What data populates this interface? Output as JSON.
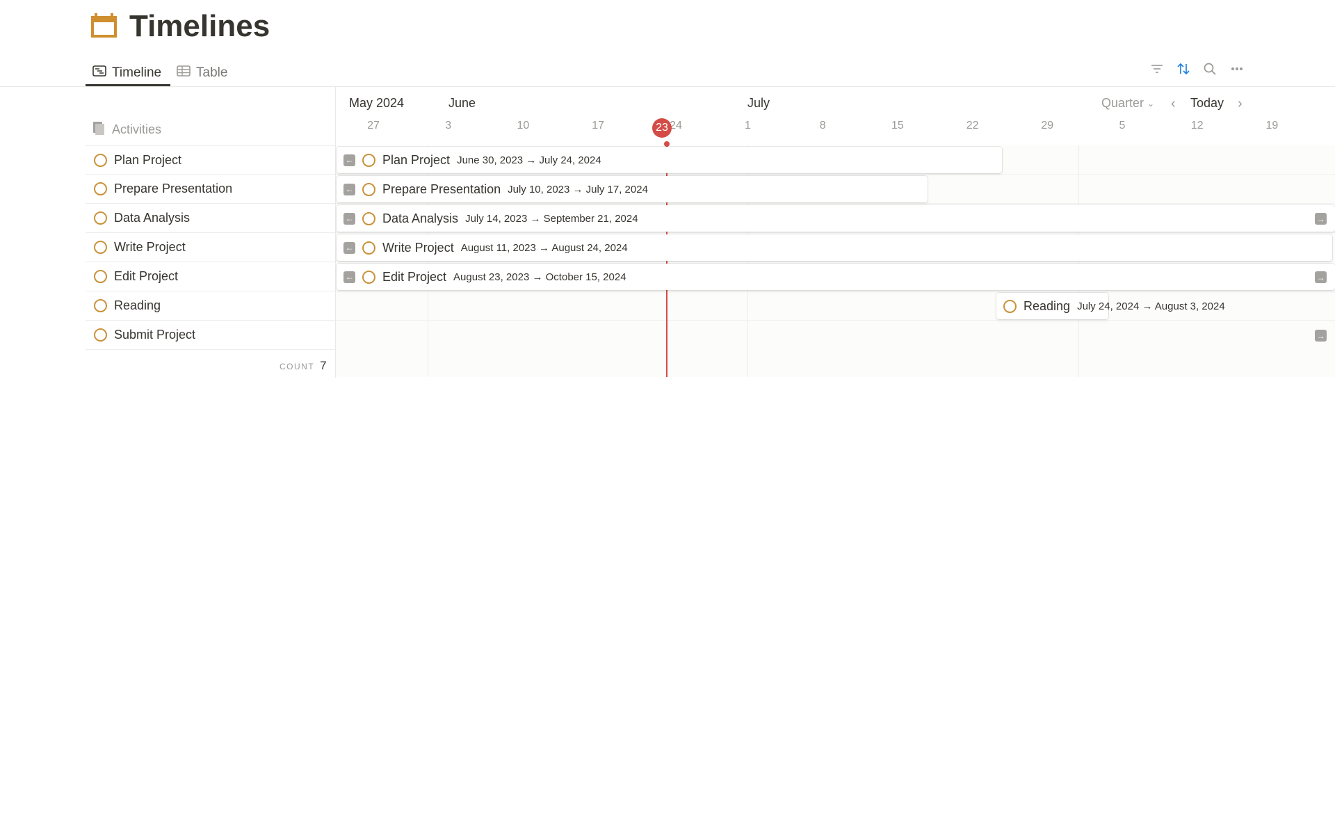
{
  "page": {
    "title": "Timelines",
    "icon": "calendar-icon"
  },
  "tabs": [
    {
      "label": "Timeline",
      "icon": "timeline-icon",
      "active": true
    },
    {
      "label": "Table",
      "icon": "table-icon",
      "active": false
    }
  ],
  "toolbar": {
    "icons": [
      "filter-icon",
      "sort-icon",
      "search-icon",
      "more-icon"
    ],
    "sort_color": "#2383e2"
  },
  "left_panel": {
    "header": "Activities",
    "count_label": "COUNT",
    "count": "7",
    "items": [
      "Plan Project",
      "Prepare Presentation",
      "Data Analysis",
      "Write Project",
      "Edit Project",
      "Reading",
      "Submit Project"
    ]
  },
  "timeline": {
    "months": [
      "May 2024",
      "June",
      "July"
    ],
    "days": [
      "27",
      "3",
      "10",
      "17",
      "24",
      "1",
      "8",
      "15",
      "22",
      "29",
      "5",
      "12",
      "19"
    ],
    "today": "23",
    "view": "Quarter",
    "today_label": "Today",
    "bars": [
      {
        "name": "Plan Project",
        "dates": "June 30, 2023 → July 24, 2024"
      },
      {
        "name": "Prepare Presentation",
        "dates": "July 10, 2023 → July 17, 2024"
      },
      {
        "name": "Data Analysis",
        "dates": "July 14, 2023 → September 21, 2024"
      },
      {
        "name": "Write Project",
        "dates": "August 11, 2023 → August 24, 2024"
      },
      {
        "name": "Edit Project",
        "dates": "August 23, 2023 → October 15, 2024"
      },
      {
        "name": "Reading",
        "dates": "July 24, 2024 → August 3, 2024"
      }
    ]
  },
  "colors": {
    "accent": "#c9923a",
    "today": "#d44c47",
    "text": "#37352f",
    "muted": "#9b9a97"
  }
}
